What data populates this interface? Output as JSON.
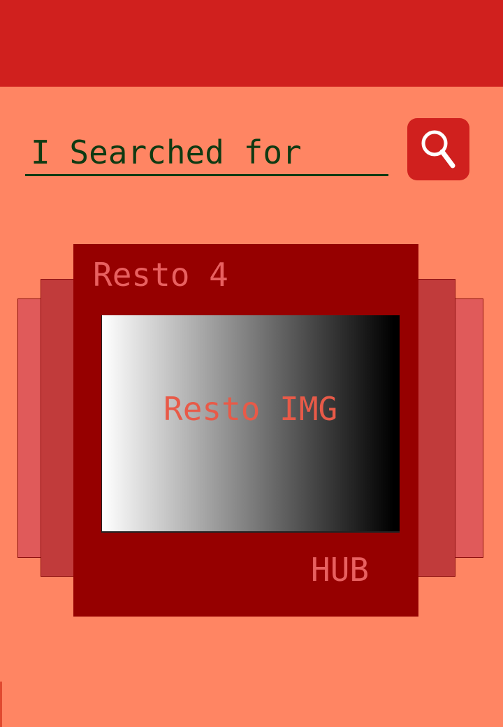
{
  "search": {
    "text": "I Searched for"
  },
  "icons": {
    "search_button": "magnifying-glass-icon"
  },
  "card": {
    "title": "Resto 4",
    "image_label": "Resto IMG",
    "footer": "HUB"
  },
  "colors": {
    "top_bar": "#d0201e",
    "background": "#ff8563",
    "card": "#960000",
    "card_back_inner": "#c13b3b",
    "card_back_outer": "#e05a5a",
    "search_text": "#0f3a12",
    "card_text": "#e86060"
  }
}
